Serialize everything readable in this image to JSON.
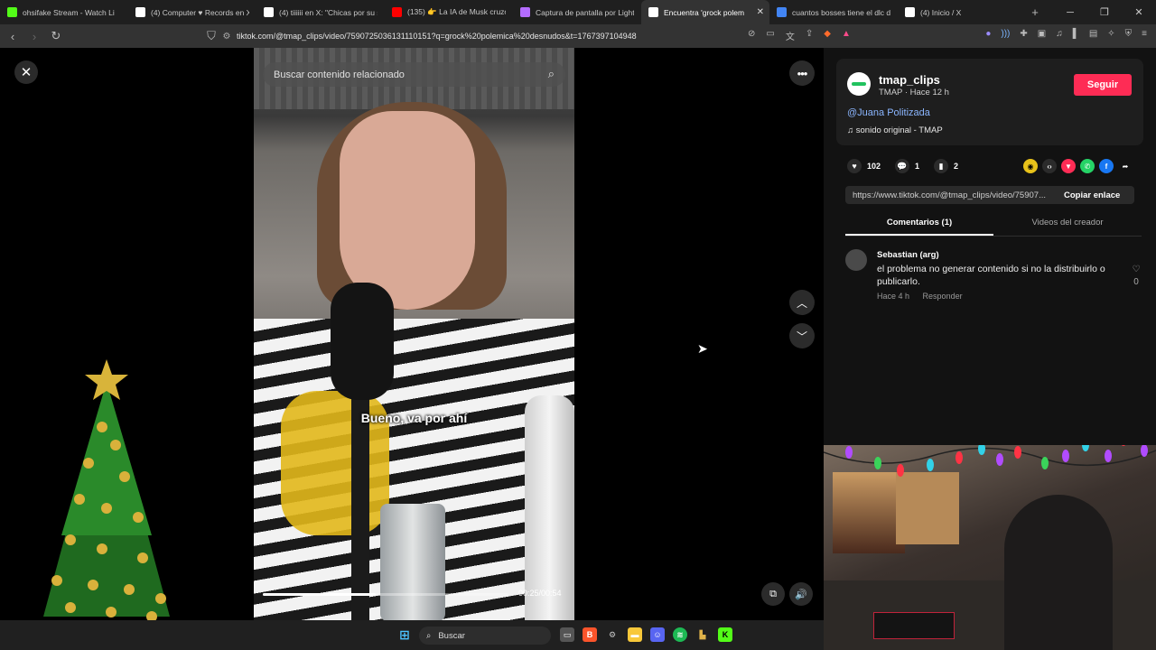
{
  "browser": {
    "tabs": [
      {
        "title": "ohsifake Stream - Watch Li",
        "icon": "kick-icon",
        "color": "#53fc18"
      },
      {
        "title": "(4) Computer ♥ Records en X",
        "icon": "x-icon",
        "color": "#ffffff"
      },
      {
        "title": "(4) tiiiiii en X: \"Chicas por su se",
        "icon": "x-icon",
        "color": "#ffffff"
      },
      {
        "title": "(135) 👉 La IA de Musk cruzó",
        "icon": "youtube-icon",
        "color": "#ff0000"
      },
      {
        "title": "Captura de pantalla por Lightsh",
        "icon": "lightshot-icon",
        "color": "#b46cff"
      },
      {
        "title": "Encuentra 'grock polem",
        "icon": "tiktok-icon",
        "color": "#ffffff",
        "active": true
      },
      {
        "title": "cuantos bosses tiene el dlc de",
        "icon": "google-icon",
        "color": "#4285f4"
      },
      {
        "title": "(4) Inicio / X",
        "icon": "x-icon",
        "color": "#ffffff"
      }
    ],
    "url": "tiktok.com/@tmap_clips/video/7590725036131110151?q=grock%20polemica%20desnudos&t=1767397104948"
  },
  "video": {
    "search_placeholder": "Buscar contenido relacionado",
    "caption": "Bueno, va por ahí",
    "time": "00:25/00:54",
    "progress_fraction": 0.46
  },
  "sidebar": {
    "username": "tmap_clips",
    "meta": "TMAP · Hace 12 h",
    "follow_label": "Seguir",
    "description": "@Juana Politizada",
    "sound": "sonido original - TMAP",
    "likes": "102",
    "comments": "1",
    "saves": "2",
    "share_link": "https://www.tiktok.com/@tmap_clips/video/75907...",
    "copy_label": "Copiar enlace",
    "tab_comments": "Comentarios (1)",
    "tab_creator": "Videos del creador",
    "comment": {
      "author": "Sebastian (arg)",
      "text": "el problema no generar contenido si no la distribuirlo o publicarlo.",
      "time": "Hace 4 h",
      "reply": "Responder",
      "likes": "0"
    }
  },
  "taskbar": {
    "search_label": "Buscar"
  }
}
